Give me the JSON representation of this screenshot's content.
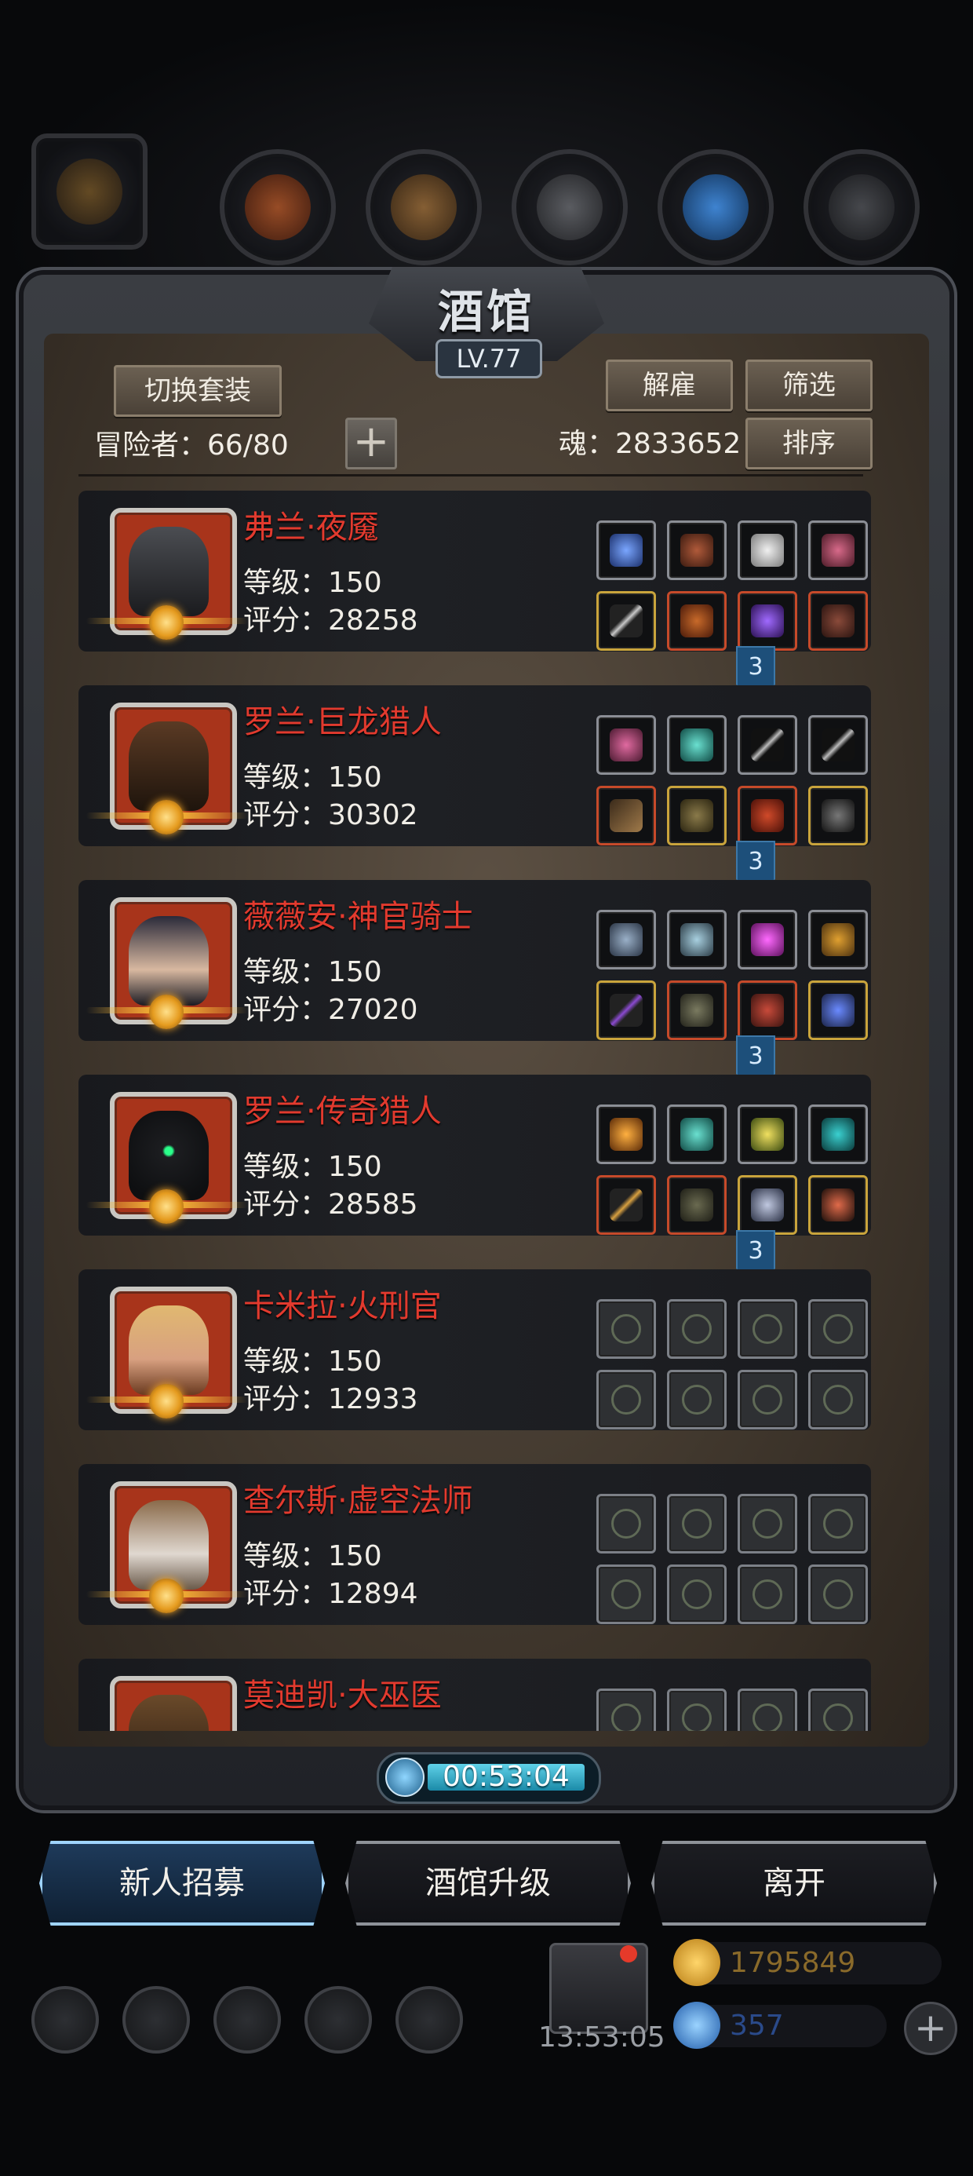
{
  "window": {
    "title": "酒馆",
    "level": "LV.77"
  },
  "toolbar": {
    "switch_outfit": "切换套装",
    "dismiss": "解雇",
    "filter": "筛选",
    "sort": "排序",
    "adventurers": "冒险者：66/80",
    "soul": "魂：2833652"
  },
  "heroes": [
    {
      "name": "弗兰·夜魇",
      "level": "等级：150",
      "score": "评分：28258",
      "badge": "3"
    },
    {
      "name": "罗兰·巨龙猎人",
      "level": "等级：150",
      "score": "评分：30302",
      "badge": "3"
    },
    {
      "name": "薇薇安·神官骑士",
      "level": "等级：150",
      "score": "评分：27020",
      "badge": "3"
    },
    {
      "name": "罗兰·传奇猎人",
      "level": "等级：150",
      "score": "评分：28585",
      "badge": "3"
    },
    {
      "name": "卡米拉·火刑官",
      "level": "等级：150",
      "score": "评分：12933"
    },
    {
      "name": "查尔斯·虚空法师",
      "level": "等级：150",
      "score": "评分：12894"
    },
    {
      "name": "莫迪凯·大巫医"
    }
  ],
  "timer": "00:53:04",
  "buttons": {
    "recruit": "新人招募",
    "upgrade": "酒馆升级",
    "leave": "离开"
  },
  "hud": {
    "gold": "1795849",
    "gems": "357",
    "chest_timer": "13:53:05"
  },
  "colors": {
    "hero_name": "#e23a2e",
    "accent_blue": "#4ab4ff"
  }
}
